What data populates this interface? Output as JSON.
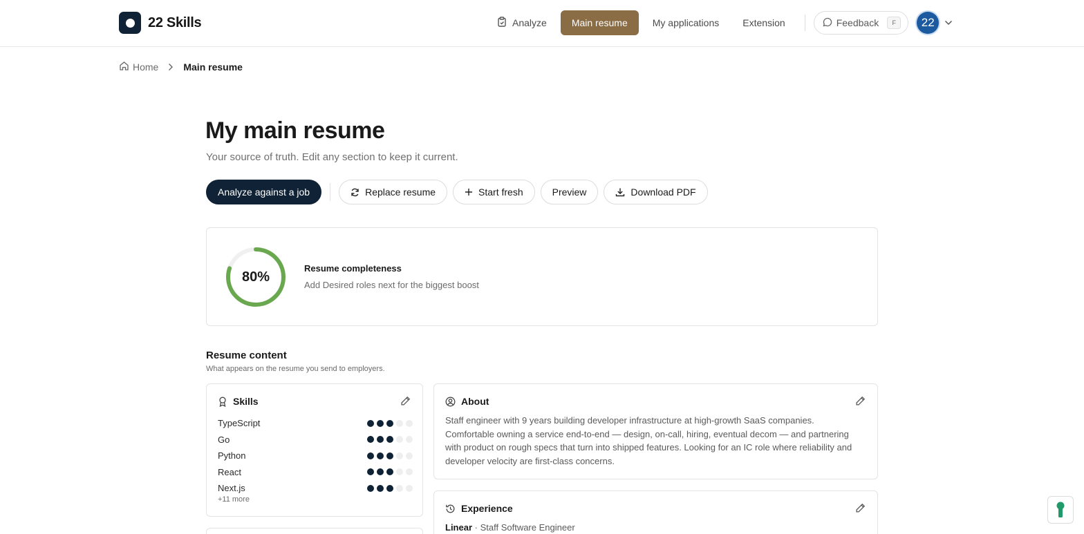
{
  "brand": {
    "name": "22 Skills"
  },
  "nav": {
    "analyze": "Analyze",
    "main_resume": "Main resume",
    "applications": "My applications",
    "extension": "Extension",
    "feedback": "Feedback",
    "feedback_shortcut": "F",
    "avatar_initials": "22"
  },
  "breadcrumb": {
    "home": "Home",
    "current": "Main resume"
  },
  "page": {
    "title": "My main resume",
    "subtitle": "Your source of truth. Edit any section to keep it current."
  },
  "actions": {
    "analyze": "Analyze against a job",
    "replace": "Replace resume",
    "start_fresh": "Start fresh",
    "preview": "Preview",
    "download": "Download PDF"
  },
  "completeness": {
    "percent_label": "80%",
    "percent_value": 80,
    "title": "Resume completeness",
    "hint": "Add Desired roles next for the biggest boost",
    "ring_color": "#6aa84f"
  },
  "content": {
    "title": "Resume content",
    "subtitle": "What appears on the resume you send to employers."
  },
  "skills": {
    "title": "Skills",
    "items": [
      {
        "name": "TypeScript",
        "level": 3
      },
      {
        "name": "Go",
        "level": 3
      },
      {
        "name": "Python",
        "level": 3
      },
      {
        "name": "React",
        "level": 3
      },
      {
        "name": "Next.js",
        "level": 3
      }
    ],
    "max_level": 5,
    "more": "+11 more"
  },
  "about": {
    "title": "About",
    "text": "Staff engineer with 9 years building developer infrastructure at high-growth SaaS companies. Comfortable owning a service end-to-end — design, on-call, hiring, eventual decom — and partnering with product on rough specs that turn into shipped features. Looking for an IC role where reliability and developer velocity are first-class concerns."
  },
  "experience": {
    "title": "Experience",
    "company": "Linear",
    "separator": " · ",
    "role": "Staff Software Engineer"
  },
  "colors": {
    "primary": "#0f2236",
    "accent": "#8a6c45",
    "avatar": "#1c5aa0"
  }
}
